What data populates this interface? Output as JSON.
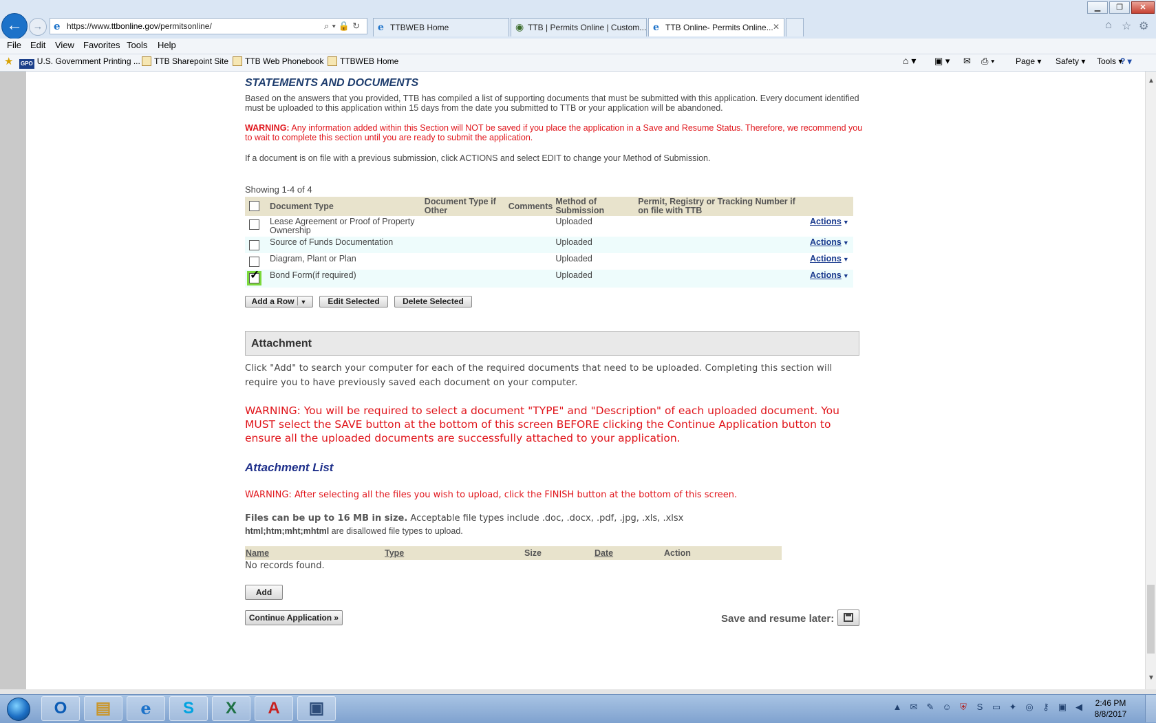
{
  "browser": {
    "url_prefix": "https://www.",
    "url_domain": "ttbonline.gov",
    "url_path": "/permitsonline/",
    "tabs": [
      {
        "label": "TTBWEB Home",
        "active": false
      },
      {
        "label": "TTB | Permits Online | Custom...",
        "active": false
      },
      {
        "label": "TTB Online- Permits Online...",
        "active": true
      }
    ],
    "tab_close": "✕",
    "menu": [
      "File",
      "Edit",
      "View",
      "Favorites",
      "Tools",
      "Help"
    ],
    "favorites": [
      {
        "label": "U.S. Government Printing ...",
        "icon": "gpo-icon",
        "badge": "GPO"
      },
      {
        "label": "TTB Sharepoint Site",
        "icon": "page-icon"
      },
      {
        "label": "TTB Web Phonebook",
        "icon": "page-icon"
      },
      {
        "label": "TTBWEB Home",
        "icon": "page-icon"
      }
    ],
    "commands": [
      "Page ▾",
      "Safety ▾",
      "Tools ▾"
    ]
  },
  "section": {
    "title": "STATEMENTS AND DOCUMENTS",
    "intro": "Based on the answers that you provided, TTB has compiled a list of supporting documents that must be submitted with this application. Every document identified must be uploaded to this application within 15 days from the date you submitted to TTB or your application will be abandoned.",
    "warning_label": "WARNING:",
    "warning_text": " Any information added within this Section will NOT be saved if you place the application in a Save and Resume Status. Therefore, we recommend you to wait to complete this section until you are ready to submit the application.",
    "note": "If a document is on file with a previous submission, click ACTIONS and select EDIT to change your Method of Submission."
  },
  "documents": {
    "showing": "Showing 1-4 of 4",
    "columns": {
      "doc_type": "Document Type",
      "doc_type_other": "Document Type if Other",
      "comments": "Comments",
      "method": "Method of Submission",
      "permit": "Permit, Registry or Tracking Number if on file with TTB"
    },
    "rows": [
      {
        "type": "Lease Agreement or Proof of Property Ownership",
        "other": "",
        "comments": "",
        "method": "Uploaded",
        "permit": "",
        "action": "Actions",
        "checked": false
      },
      {
        "type": "Source of Funds Documentation",
        "other": "",
        "comments": "",
        "method": "Uploaded",
        "permit": "",
        "action": "Actions",
        "checked": false
      },
      {
        "type": "Diagram, Plant or Plan",
        "other": "",
        "comments": "",
        "method": "Uploaded",
        "permit": "",
        "action": "Actions",
        "checked": false
      },
      {
        "type": "Bond Form(if required)",
        "other": "",
        "comments": "",
        "method": "Uploaded",
        "permit": "",
        "action": "Actions",
        "checked": true
      }
    ],
    "buttons": {
      "add_row": "Add a Row",
      "edit_selected": "Edit Selected",
      "delete_selected": "Delete Selected"
    }
  },
  "attachment": {
    "header": "Attachment",
    "description": "Click \"Add\" to search your computer for each of the required documents that need to be uploaded.  Completing this section will require you to have previously saved each document on your computer.",
    "warning": "WARNING: You will be required to select a document \"TYPE\" and \"Description\" of each uploaded document. You MUST select the SAVE button at the bottom of this screen BEFORE clicking the Continue Application button to ensure all the uploaded documents are successfully attached to your application.",
    "list_title": "Attachment List",
    "finish_warning": "WARNING: After selecting all the files you wish to upload, click the FINISH button at the bottom of this screen.",
    "size_bold": "Files can be up to 16 MB in size.",
    "size_rest": " Acceptable file types include .doc, .docx, .pdf, .jpg, .xls, .xlsx",
    "disallowed_bold": "html;htm;mht;mhtml",
    "disallowed_rest": " are disallowed file types to upload.",
    "columns": {
      "name": "Name",
      "type": "Type",
      "size": "Size",
      "date": "Date",
      "action": "Action"
    },
    "empty": "No records found.",
    "add_button": "Add",
    "continue_button": "Continue Application »",
    "save_resume_label": "Save and resume later:"
  },
  "taskbar": {
    "clock_time": "2:46 PM",
    "clock_date": "8/8/2017"
  },
  "colors": {
    "warning_red": "#e0151b",
    "heading_blue": "#1e3d6e",
    "table_header": "#e8e3cc",
    "alt_row": "#eefcfc",
    "checked_outline": "#7bd93a"
  }
}
